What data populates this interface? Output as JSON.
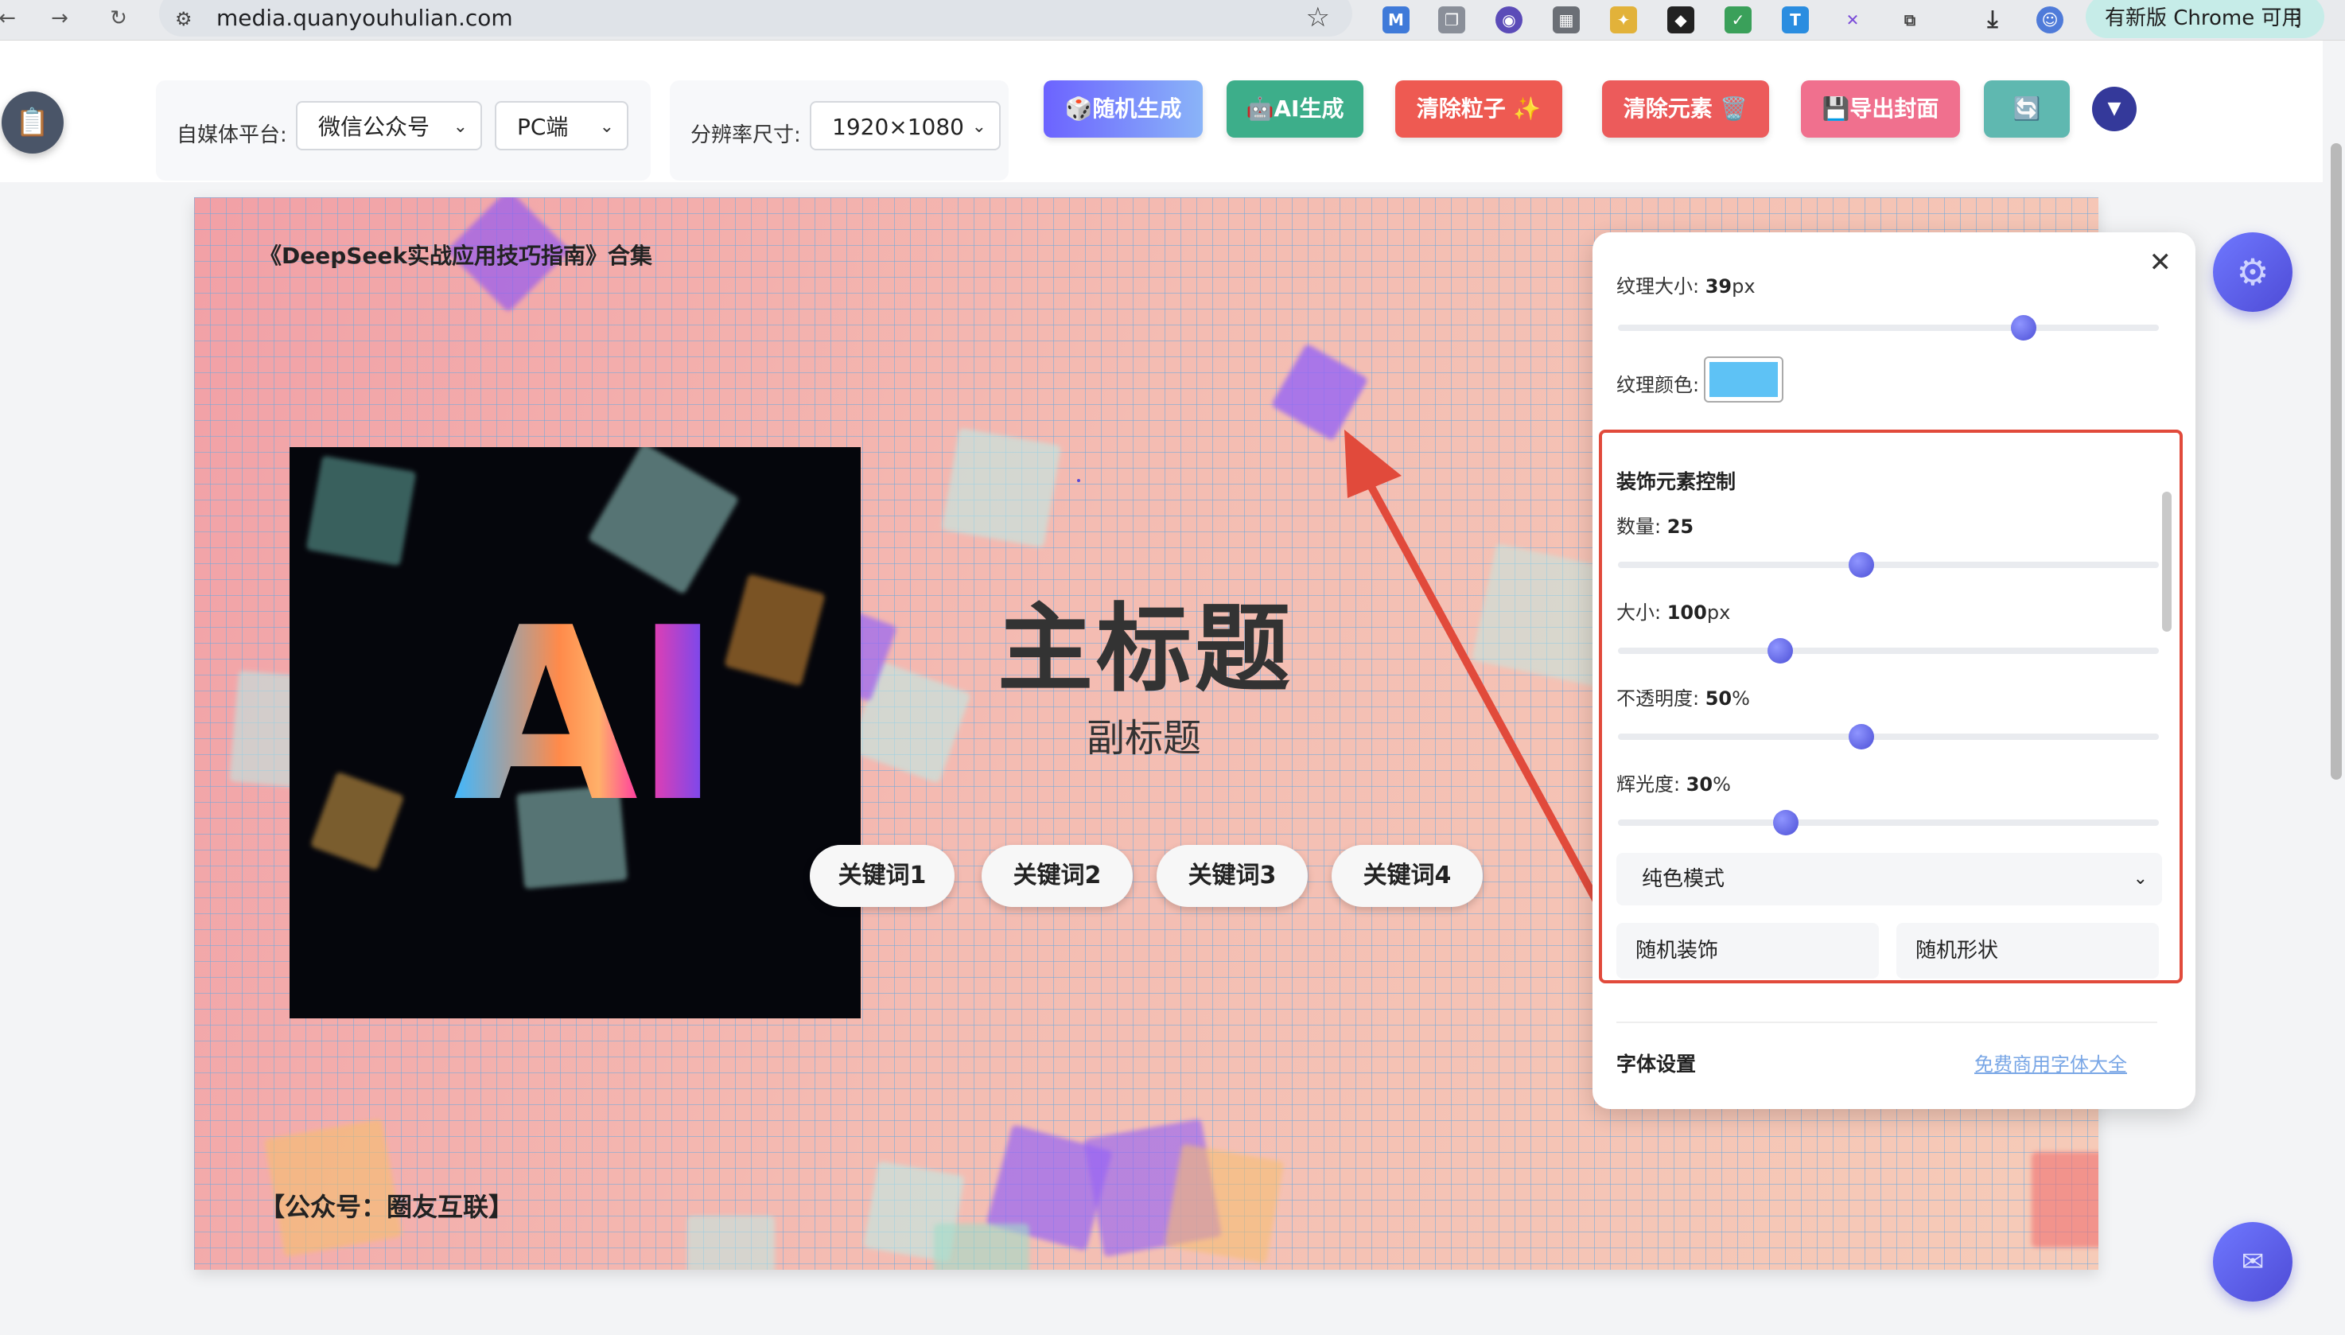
{
  "browser": {
    "url": "media.quanyouhulian.com",
    "update_label": "有新版 Chrome 可用"
  },
  "toolbar": {
    "platform_label": "自媒体平台:",
    "platform_value": "微信公众号",
    "device_value": "PC端",
    "resolution_label": "分辨率尺寸:",
    "resolution_value": "1920×1080",
    "buttons": {
      "random": "🎲随机生成",
      "ai": "🤖AI生成",
      "clear_particles": "清除粒子 ✨",
      "clear_elements": "清除元素 🗑️",
      "export": "💾导出封面",
      "refresh": "🔄"
    },
    "colors": {
      "random_start": "#6c63ff",
      "random_end": "#8ab4f8",
      "ai": "#3dae8a",
      "clear_particles": "#ee5a52",
      "clear_elements": "#ec5b5b",
      "export": "#f0708e",
      "refresh": "#5fb8b0"
    }
  },
  "canvas": {
    "top_text": "《DeepSeek实战应用技巧指南》合集",
    "image_text": "AI",
    "main_title": "主标题",
    "subtitle": "副标题",
    "keywords": [
      "关键词1",
      "关键词2",
      "关键词3",
      "关键词4"
    ],
    "bottom_text": "【公众号：圈友互联】"
  },
  "panel": {
    "texture_size_label": "纹理大小:",
    "texture_size_value": "39",
    "texture_size_unit": "px",
    "texture_size_fraction": 0.75,
    "texture_color_label": "纹理颜色:",
    "texture_color": "#5ec2f5",
    "decor_title": "装饰元素控制",
    "count_label": "数量:",
    "count_value": "25",
    "count_fraction": 0.45,
    "size_label": "大小:",
    "size_value": "100",
    "size_unit": "px",
    "size_fraction": 0.3,
    "opacity_label": "不透明度:",
    "opacity_value": "50",
    "opacity_unit": "%",
    "opacity_fraction": 0.45,
    "glow_label": "辉光度:",
    "glow_value": "30",
    "glow_unit": "%",
    "glow_fraction": 0.31,
    "mode_value": "纯色模式",
    "random_decor": "随机装饰",
    "random_shape": "随机形状",
    "font_settings": "字体设置",
    "font_link": "免费商用字体大全"
  },
  "icons": {
    "clipboard": "clipboard-icon",
    "gear": "gear-icon",
    "mail": "mail-icon",
    "close": "close-icon"
  }
}
